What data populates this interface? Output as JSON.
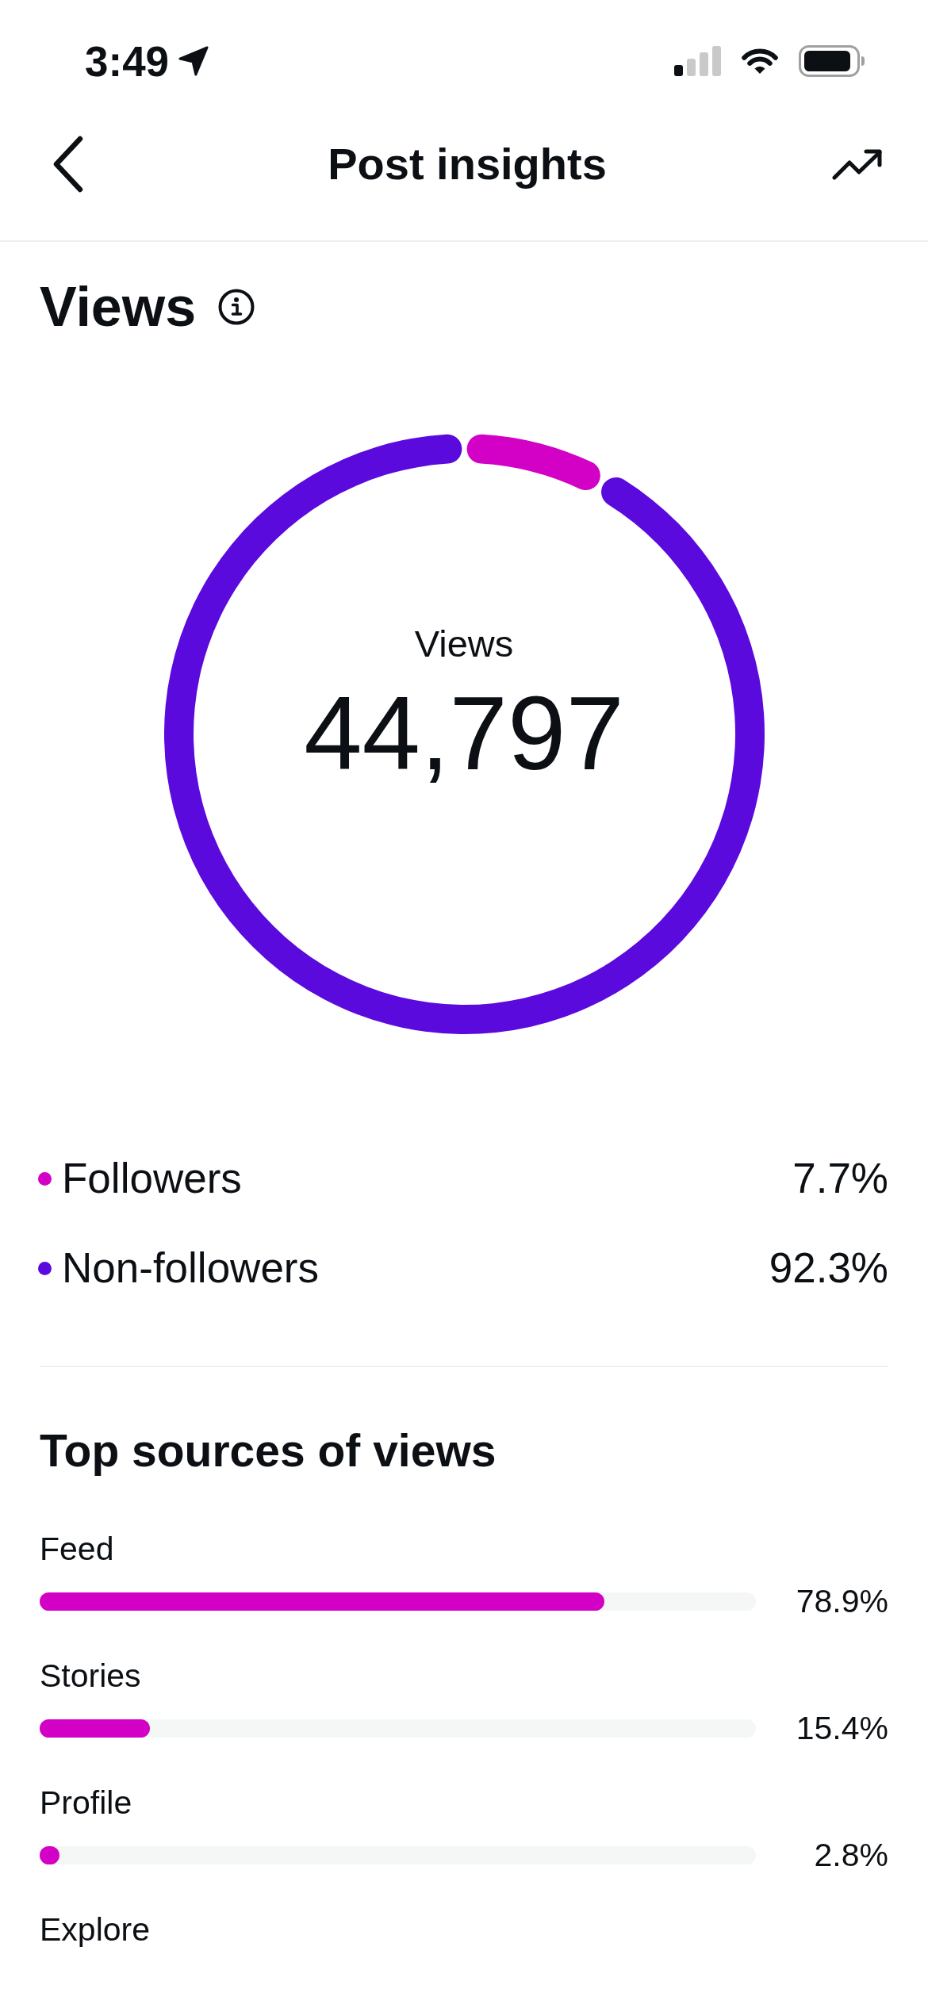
{
  "status_bar": {
    "time": "3:49"
  },
  "header": {
    "title": "Post insights"
  },
  "views": {
    "title": "Views",
    "center_label": "Views",
    "total": "44,797",
    "chart_data": {
      "type": "donut",
      "categories": [
        "Followers",
        "Non-followers"
      ],
      "values": [
        7.7,
        92.3
      ]
    },
    "legend": [
      {
        "percent": "7.7%",
        "color": "#d300c5"
      },
      {
        "percent": "92.3%",
        "color": "#5b0ade"
      }
    ]
  },
  "top_sources": {
    "title": "Top sources of views",
    "items": [
      {
        "label": "Feed",
        "level": 0.789,
        "percent": "78.9%"
      },
      {
        "label": "Stories",
        "level": 0.154,
        "percent": "15.4%"
      },
      {
        "label": "Profile",
        "level": 0.028,
        "percent": "2.8%"
      },
      {
        "label": "Explore"
      }
    ]
  }
}
